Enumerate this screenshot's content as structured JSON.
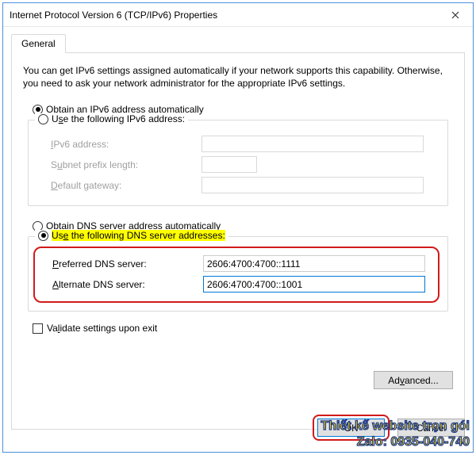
{
  "window": {
    "title": "Internet Protocol Version 6 (TCP/IPv6) Properties"
  },
  "tab": {
    "general": "General"
  },
  "intro": "You can get IPv6 settings assigned automatically if your network supports this capability. Otherwise, you need to ask your network administrator for the appropriate IPv6 settings.",
  "ip": {
    "auto": "Obtain an IPv6 address automatically",
    "manual": "Use the following IPv6 address:",
    "addr_label": "IPv6 address:",
    "prefix_label": "Subnet prefix length:",
    "gateway_label": "Default gateway:"
  },
  "dns": {
    "auto": "Obtain DNS server address automatically",
    "manual": "Use the following DNS server addresses:",
    "pref_label": "Preferred DNS server:",
    "alt_label": "Alternate DNS server:",
    "pref_value": "2606:4700:4700::1111",
    "alt_value": "2606:4700:4700::1001"
  },
  "validate": "Validate settings upon exit",
  "buttons": {
    "advanced": "Advanced...",
    "ok": "OK",
    "cancel": "Cancel"
  },
  "overlay": {
    "line1": "Thiết kế website trọn gói",
    "line2": "Zalo: 0935-040-740"
  }
}
